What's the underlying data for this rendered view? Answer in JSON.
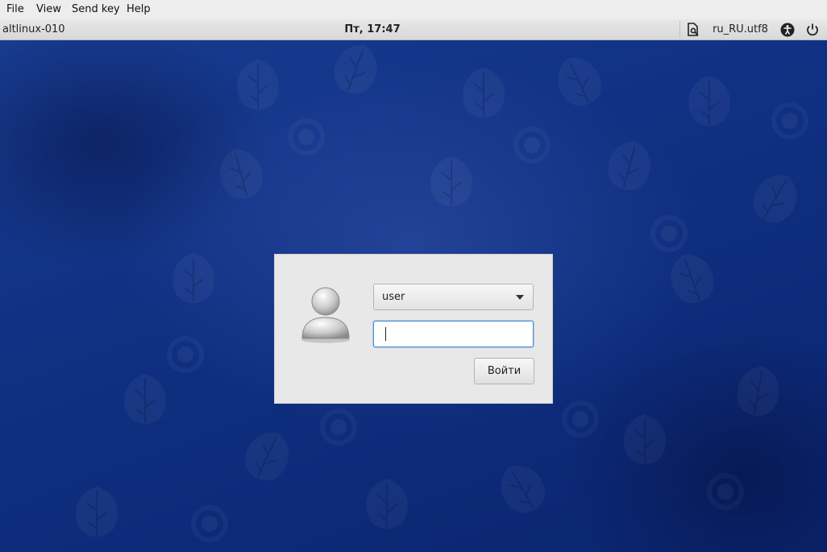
{
  "menubar": {
    "items": [
      {
        "label": "File"
      },
      {
        "label": "View"
      },
      {
        "label": "Send key"
      },
      {
        "label": "Help"
      }
    ]
  },
  "panel": {
    "hostname": "altlinux-010",
    "clock": "Пт, 17:47",
    "locale": "ru_RU.utf8",
    "icons": [
      "keyboard-layout-icon",
      "accessibility-icon",
      "power-icon"
    ]
  },
  "login": {
    "avatar_icon": "user-avatar-icon",
    "selected_user": "user",
    "password_value": "",
    "login_button": "Войти"
  },
  "colors": {
    "desktop_blue": "#0f2f80",
    "focus_ring": "#4a8fd6"
  }
}
